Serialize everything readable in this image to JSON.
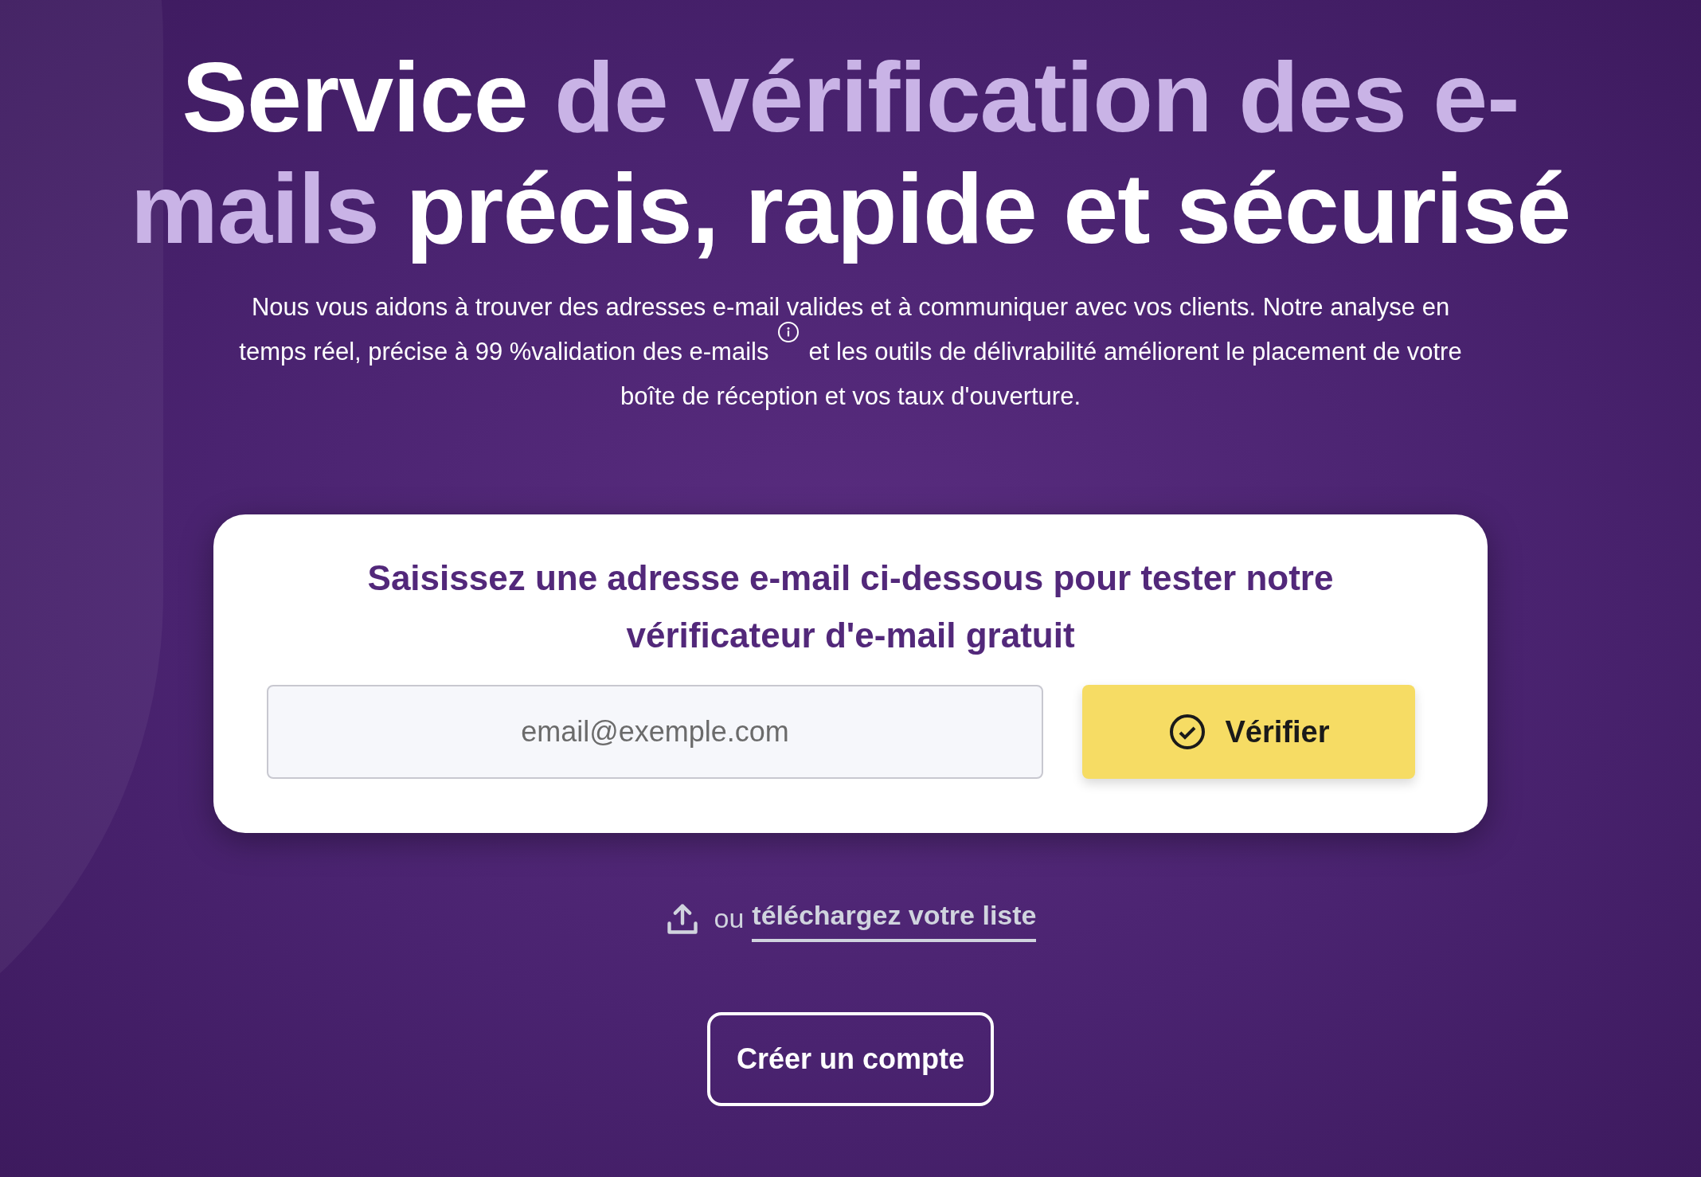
{
  "headline": [
    {
      "text": "Service",
      "highlight": false
    },
    {
      "text": "de vérification des e-mails",
      "highlight": true
    },
    {
      "text": "précis, rapide et sécurisé",
      "highlight": false
    }
  ],
  "intro": {
    "before": "Nous vous aidons à trouver des adresses e-mail valides et à communiquer avec vos clients. Notre analyse en temps réel, précise à 99 %validation des e-mails",
    "after": "et les outils de délivrabilité améliorent le placement de votre boîte de réception et vos taux d'ouverture."
  },
  "card": {
    "title": "Saisissez une adresse e-mail ci-dessous pour tester notre vérificateur d'e-mail gratuit",
    "email_field": {
      "placeholder": "email@exemple.com"
    },
    "verify_button": "Vérifier"
  },
  "upload": {
    "prefix": "ou",
    "link": "téléchargez votre liste"
  },
  "signup_button": "Créer un compte"
}
